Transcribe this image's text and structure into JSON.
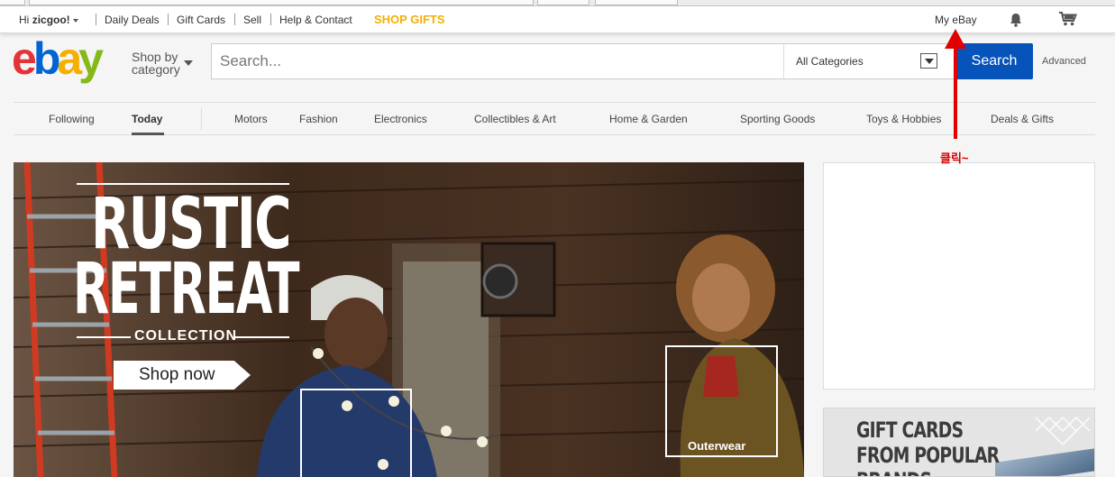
{
  "topbar": {
    "greeting_prefix": "Hi",
    "greeting_name": "zicgoo!",
    "links": [
      "Daily Deals",
      "Gift Cards",
      "Sell",
      "Help & Contact"
    ],
    "shop_gifts": "SHOP GIFTS",
    "my_ebay": "My eBay",
    "icons": [
      "bell-icon",
      "cart-icon"
    ]
  },
  "header": {
    "logo": [
      "e",
      "b",
      "a",
      "y"
    ],
    "shop_by_line1": "Shop by",
    "shop_by_line2": "category",
    "search_placeholder": "Search...",
    "category_value": "All Categories",
    "search_button": "Search",
    "advanced": "Advanced"
  },
  "nav": {
    "items": [
      "Following",
      "Today",
      "Motors",
      "Fashion",
      "Electronics",
      "Collectibles & Art",
      "Home & Garden",
      "Sporting Goods",
      "Toys & Hobbies",
      "Deals & Gifts"
    ],
    "active": "Today"
  },
  "hero": {
    "title_line1": "RUSTIC",
    "title_line2": "RETREAT",
    "subtitle": "COLLECTION",
    "cta": "Shop now",
    "tag_outerwear": "Outerwear"
  },
  "giftcards": {
    "line1": "GIFT CARDS",
    "line2": "FROM POPULAR",
    "line3": "BRANDS"
  },
  "annotation": {
    "label": "클릭~",
    "color": "#e00000"
  },
  "colors": {
    "logo_e": "#e53238",
    "logo_b": "#0064d2",
    "logo_a": "#f5af02",
    "logo_y": "#86b817",
    "search_button": "#0654ba",
    "shop_gifts": "#f5af02"
  }
}
